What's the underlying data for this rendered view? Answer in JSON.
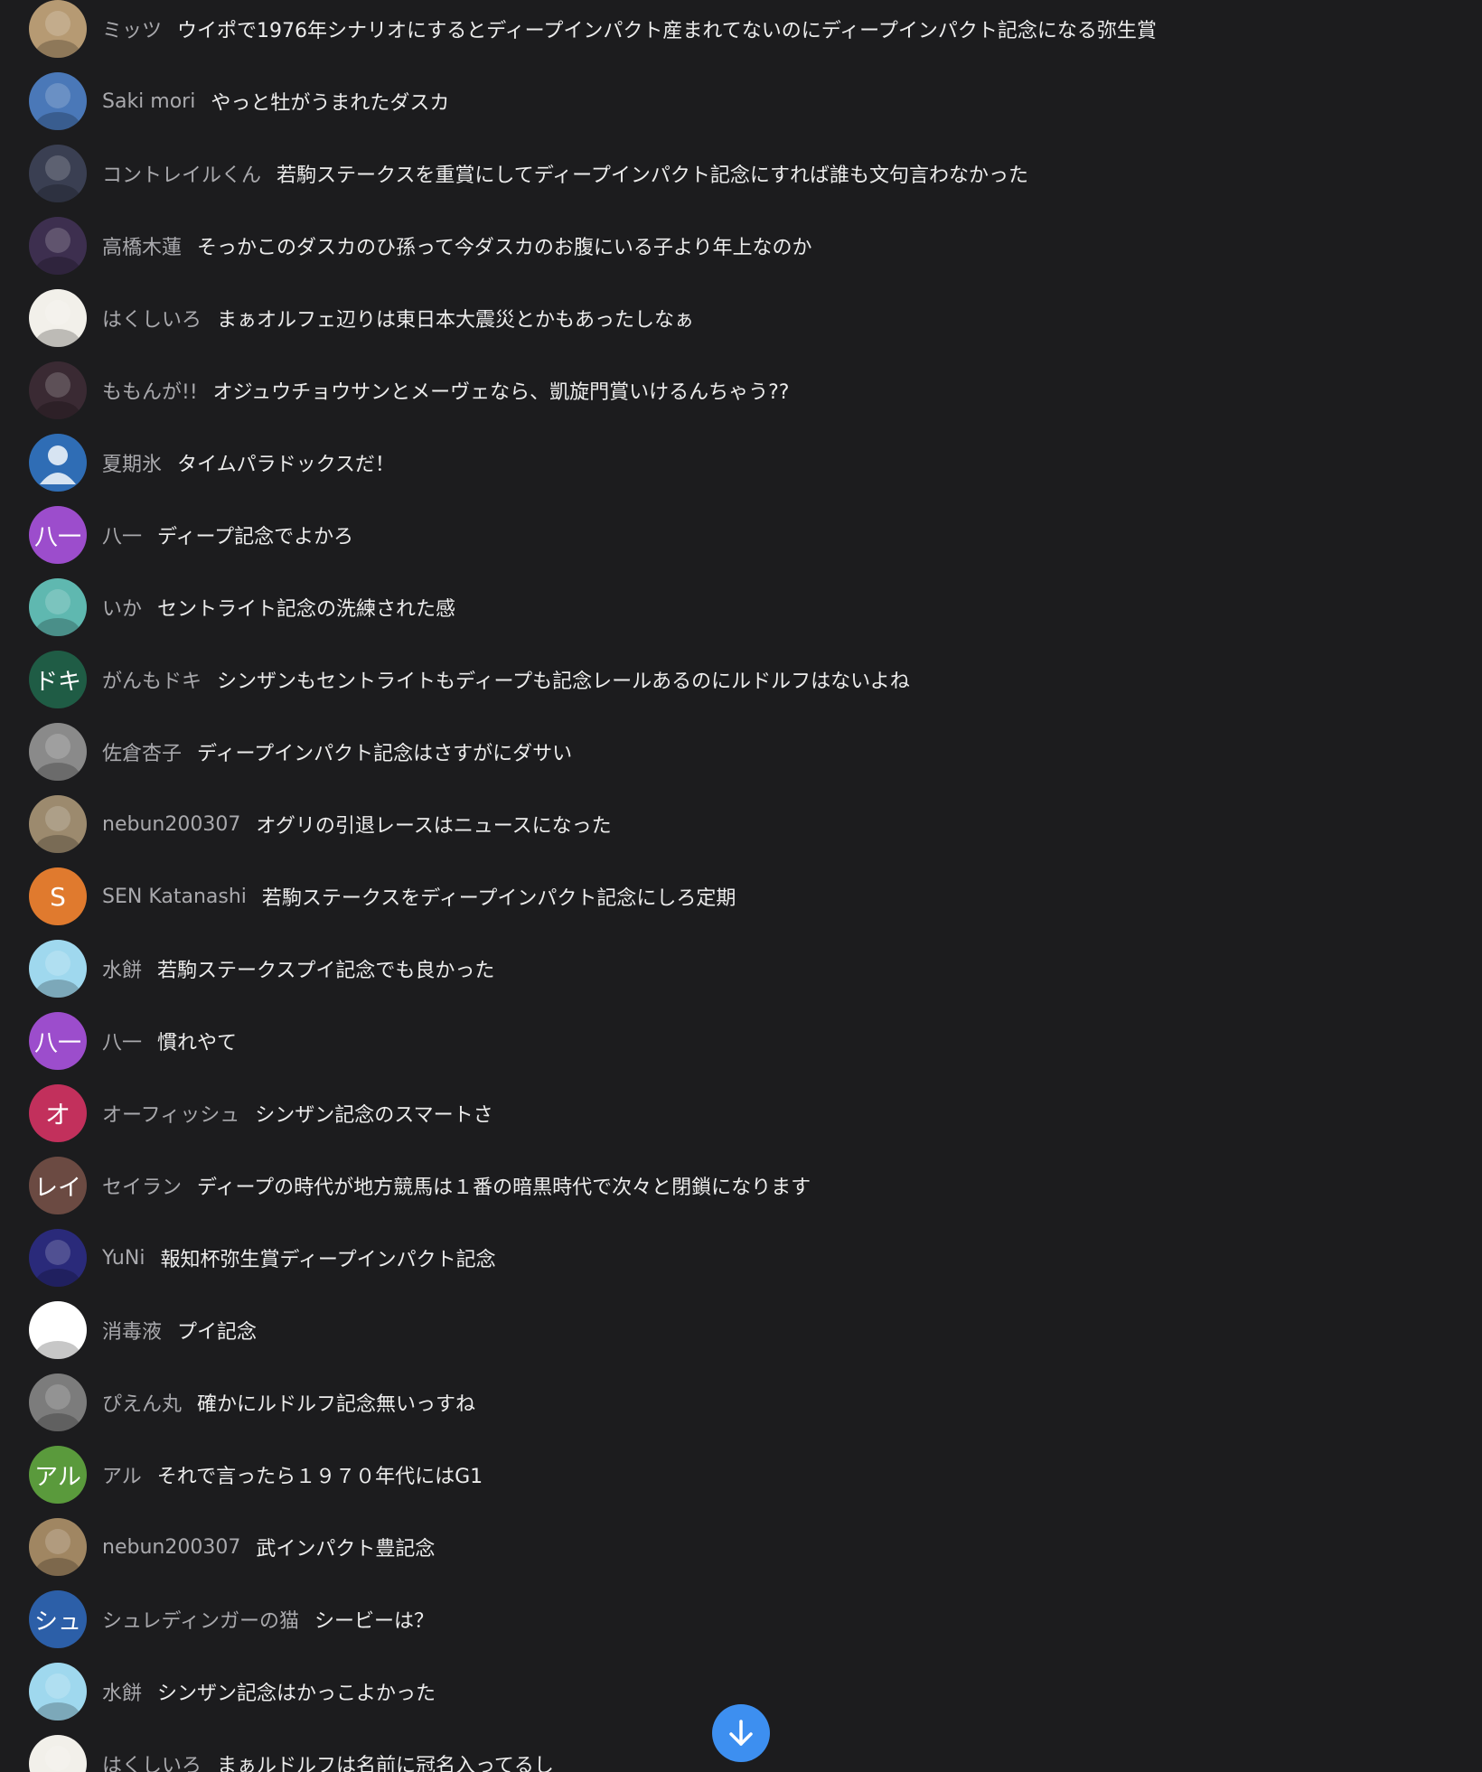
{
  "colors": {
    "background": "#1c1c1e",
    "author_text": "#a9a9ad",
    "message_text": "#ececec",
    "scroll_button": "#3d8ff0"
  },
  "scroll_button": {
    "icon": "arrow-down-icon"
  },
  "messages": [
    {
      "author": "ミッツ",
      "text": "ウイポで1976年シナリオにするとディープインパクト産まれてないのにディープインパクト記念になる弥生賞",
      "avatar": {
        "type": "image",
        "icon": "avatar-photo-icon",
        "color": "#b69a73"
      }
    },
    {
      "author": "Saki mori",
      "text": "やっと牡がうまれたダスカ",
      "avatar": {
        "type": "image",
        "icon": "horse-mask-avatar-icon",
        "color": "#4a78b8"
      }
    },
    {
      "author": "コントレイルくん",
      "text": "若駒ステークスを重賞にしてディープインパクト記念にすれば誰も文句言わなかった",
      "avatar": {
        "type": "image",
        "icon": "racehorse-avatar-icon",
        "color": "#3a3f52"
      }
    },
    {
      "author": "高橋木蓮",
      "text": "そっかこのダスカのひ孫って今ダスカのお腹にいる子より年上なのか",
      "avatar": {
        "type": "image",
        "icon": "anime-character-avatar-icon",
        "color": "#3d2f4f"
      }
    },
    {
      "author": "はくしいろ",
      "text": "まぁオルフェ辺りは東日本大震災とかもあったしなぁ",
      "avatar": {
        "type": "image",
        "icon": "anime-character-avatar-icon",
        "color": "#f2f0ea"
      }
    },
    {
      "author": "ももんが!!",
      "text": "オジュウチョウサンとメーヴェなら、凱旋門賞いけるんちゃう??",
      "avatar": {
        "type": "image",
        "icon": "anime-character-avatar-icon",
        "color": "#3a2a33"
      }
    },
    {
      "author": "夏期氷",
      "text": "タイムパラドックスだ！",
      "avatar": {
        "type": "image",
        "icon": "default-person-avatar-icon",
        "color": "#2f6db5"
      }
    },
    {
      "author": "八一",
      "text": "ディープ記念でよかろ",
      "avatar": {
        "type": "initial",
        "initial": "八一",
        "color": "#9c4dcc"
      }
    },
    {
      "author": "いか",
      "text": "セントライト記念の洗練された感",
      "avatar": {
        "type": "image",
        "icon": "pixel-art-avatar-icon",
        "color": "#5fb8b0"
      }
    },
    {
      "author": "がんもドキ",
      "text": "シンザンもセントライトもディープも記念レールあるのにルドルフはないよね",
      "avatar": {
        "type": "initial",
        "initial": "ドキ",
        "color": "#1f5c45"
      }
    },
    {
      "author": "佐倉杏子",
      "text": "ディープインパクト記念はさすがにダサい",
      "avatar": {
        "type": "image",
        "icon": "white-horse-avatar-icon",
        "color": "#8a8a8a"
      }
    },
    {
      "author": "nebun200307",
      "text": "オグリの引退レースはニュースになった",
      "avatar": {
        "type": "image",
        "icon": "cat-avatar-icon",
        "color": "#9c8a6e"
      }
    },
    {
      "author": "SEN Katanashi",
      "text": "若駒ステークスをディープインパクト記念にしろ定期",
      "avatar": {
        "type": "initial",
        "initial": "S",
        "color": "#e07a2e"
      }
    },
    {
      "author": "水餅",
      "text": "若駒ステークスプイ記念でも良かった",
      "avatar": {
        "type": "image",
        "icon": "anime-character-avatar-icon",
        "color": "#9fd8ee"
      }
    },
    {
      "author": "八一",
      "text": "慣れやて",
      "avatar": {
        "type": "initial",
        "initial": "八一",
        "color": "#9c4dcc"
      }
    },
    {
      "author": "オーフィッシュ",
      "text": "シンザン記念のスマートさ",
      "avatar": {
        "type": "initial",
        "initial": "オ",
        "color": "#c2305c"
      }
    },
    {
      "author": "セイラン",
      "text": "ディープの時代が地方競馬は１番の暗黒時代で次々と閉鎖になります",
      "avatar": {
        "type": "initial",
        "initial": "レイ",
        "color": "#6b4a42"
      }
    },
    {
      "author": "YuNi",
      "text": "報知杯弥生賞ディープインパクト記念",
      "avatar": {
        "type": "image",
        "icon": "paint-splatter-avatar-icon",
        "color": "#2a2a7a"
      }
    },
    {
      "author": "消毒液",
      "text": "プイ記念",
      "avatar": {
        "type": "image",
        "icon": "doodle-face-avatar-icon",
        "color": "#ffffff"
      }
    },
    {
      "author": "ぴえん丸",
      "text": "確かにルドルフ記念無いっすね",
      "avatar": {
        "type": "image",
        "icon": "cat-avatar-icon",
        "color": "#7c7c7c"
      }
    },
    {
      "author": "アル",
      "text": "それで言ったら１９７０年代にはG1",
      "avatar": {
        "type": "initial",
        "initial": "アル",
        "color": "#5a9a3c"
      }
    },
    {
      "author": "nebun200307",
      "text": "武インパクト豊記念",
      "avatar": {
        "type": "image",
        "icon": "cat-avatar-icon",
        "color": "#a08662"
      }
    },
    {
      "author": "シュレディンガーの猫",
      "text": "シービーは？",
      "avatar": {
        "type": "initial",
        "initial": "シュ",
        "color": "#2c5fa8"
      }
    },
    {
      "author": "水餅",
      "text": "シンザン記念はかっこよかった",
      "avatar": {
        "type": "image",
        "icon": "anime-character-avatar-icon",
        "color": "#9fd8ee"
      }
    },
    {
      "author": "はくしいろ",
      "text": "まぁルドルフは名前に冠名入ってるし",
      "avatar": {
        "type": "image",
        "icon": "anime-character-avatar-icon",
        "color": "#f2f0ea"
      }
    }
  ]
}
